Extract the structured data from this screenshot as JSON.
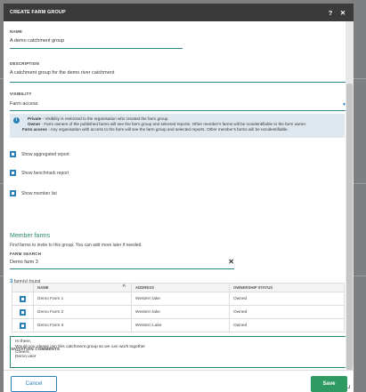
{
  "header": {
    "title": "CREATE FARM GROUP",
    "help_icon": "?",
    "close_icon": "✕"
  },
  "name": {
    "label": "NAME",
    "value": "A demo catchment group"
  },
  "description": {
    "label": "DESCRIPTION",
    "value": "A catchment group for the demo river catchment"
  },
  "visibility": {
    "label": "VISIBILITY",
    "value": "Farm access"
  },
  "notice": {
    "private_label": "Private",
    "private_text": " - Visibility is restricted to the organisation who created the farm group.",
    "owner_label": "Owner",
    "owner_text": " - Farm owners of the published farms will see the farm group and selected reports. Other member's farms will be nonidentifiable to the farm owner.",
    "farm_access_label": "Farm access",
    "farm_access_text": " - Any organisation with access to the farm will see the farm group and selected reports. Other member's farms will be nonidentifiable."
  },
  "options": [
    {
      "label": "Show aggregated report"
    },
    {
      "label": "Show benchmark report"
    },
    {
      "label": "Show member list"
    }
  ],
  "members": {
    "title": "Member farms",
    "subtitle": "Find farms to invite to this group. You can add more later if needed.",
    "search_label": "FARM SEARCH",
    "search_value": "Demo farm 3",
    "found_count": "3",
    "found_text": " farm(s) found"
  },
  "table": {
    "headers": [
      "NAME",
      "ADDRESS",
      "OWNERSHIP STATUS"
    ],
    "rows": [
      {
        "name": "Demo Farm 1",
        "address": "Western lake",
        "status": "Owned"
      },
      {
        "name": "Demo Farm 2",
        "address": "Western lake",
        "status": "Owned"
      },
      {
        "name": "Demo Farm 3",
        "address": "Western Lake",
        "status": "Owned"
      }
    ]
  },
  "comments": {
    "label": "INVITATION COMMENTS",
    "value": "Hi there,\nWould you please join this catchment group so we can work together\nCheers,\nDemo user"
  },
  "footer": {
    "cancel_label": "Cancel",
    "save_label": "Save"
  },
  "colors": {
    "accent": "#2a7fb8",
    "save": "#2f9a62",
    "header": "#3a3a3a"
  }
}
